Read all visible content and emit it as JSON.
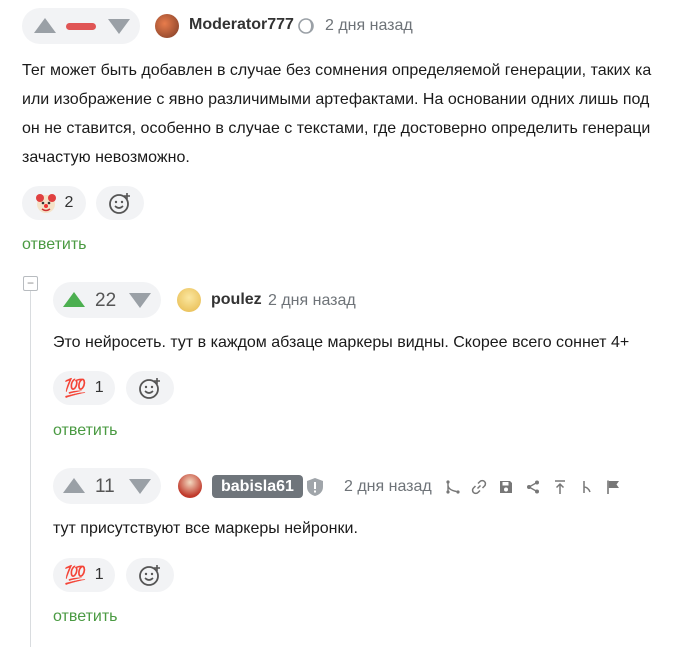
{
  "comments": [
    {
      "score": "",
      "author": "Moderator777",
      "time": "2 дня назад",
      "text": [
        "Тег может быть добавлен в случае без сомнения определяемой генерации, таких ка",
        "или изображение с явно различимыми артефактами. На основании одних лишь под",
        "он не ставится, особенно в случае с текстами, где достоверно определить генераци",
        "зачастую невозможно."
      ],
      "reaction": {
        "icon": "clown-emoji",
        "count": "2"
      },
      "reply_label": "ответить"
    },
    {
      "score": "22",
      "author": "poulez",
      "time": "2 дня назад",
      "text": [
        "Это нейросеть. тут в каждом абзаце маркеры видны. Скорее всего соннет 4+"
      ],
      "reaction": {
        "icon": "hundred-emoji",
        "glyph": "💯",
        "count": "1"
      },
      "reply_label": "ответить"
    },
    {
      "score": "11",
      "author": "babisla61",
      "time": "2 дня назад",
      "text": [
        "тут присутствуют все маркеры нейронки."
      ],
      "reaction": {
        "icon": "hundred-emoji",
        "glyph": "💯",
        "count": "1"
      },
      "reply_label": "ответить"
    }
  ],
  "collapse_glyph": "−",
  "colors": {
    "upvote_green": "#4caf50",
    "reply_green": "#4a9a42",
    "moderator_bar": "#e05555",
    "badge_bg": "#6f757b"
  }
}
